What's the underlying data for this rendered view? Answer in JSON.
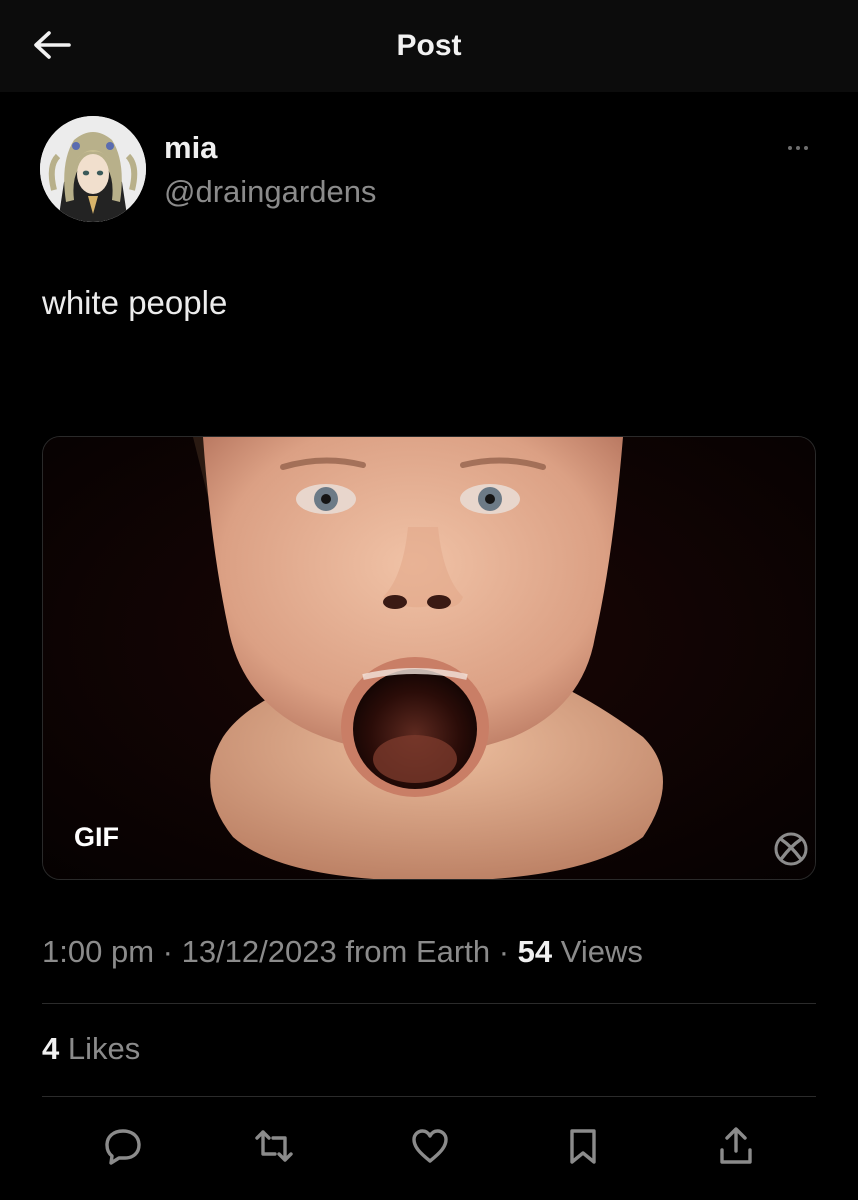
{
  "header": {
    "title": "Post",
    "back_icon": "arrow-left-icon"
  },
  "author": {
    "name": "mia",
    "handle": "@draingardens"
  },
  "post": {
    "text": "white people",
    "media": {
      "badge": "GIF"
    },
    "time": "1:00 pm",
    "date": "13/12/2023",
    "source": "from Earth",
    "views_count": "54",
    "views_label": "Views",
    "likes_count": "4",
    "likes_label": "Likes"
  },
  "actions": [
    {
      "icon": "reply-icon"
    },
    {
      "icon": "repost-icon"
    },
    {
      "icon": "like-icon"
    },
    {
      "icon": "bookmark-icon"
    },
    {
      "icon": "share-icon"
    }
  ],
  "colors": {
    "background": "#000000",
    "header": "#0c0c0c",
    "secondary_text": "#8b8b8b",
    "icon": "#8b8b8b"
  }
}
